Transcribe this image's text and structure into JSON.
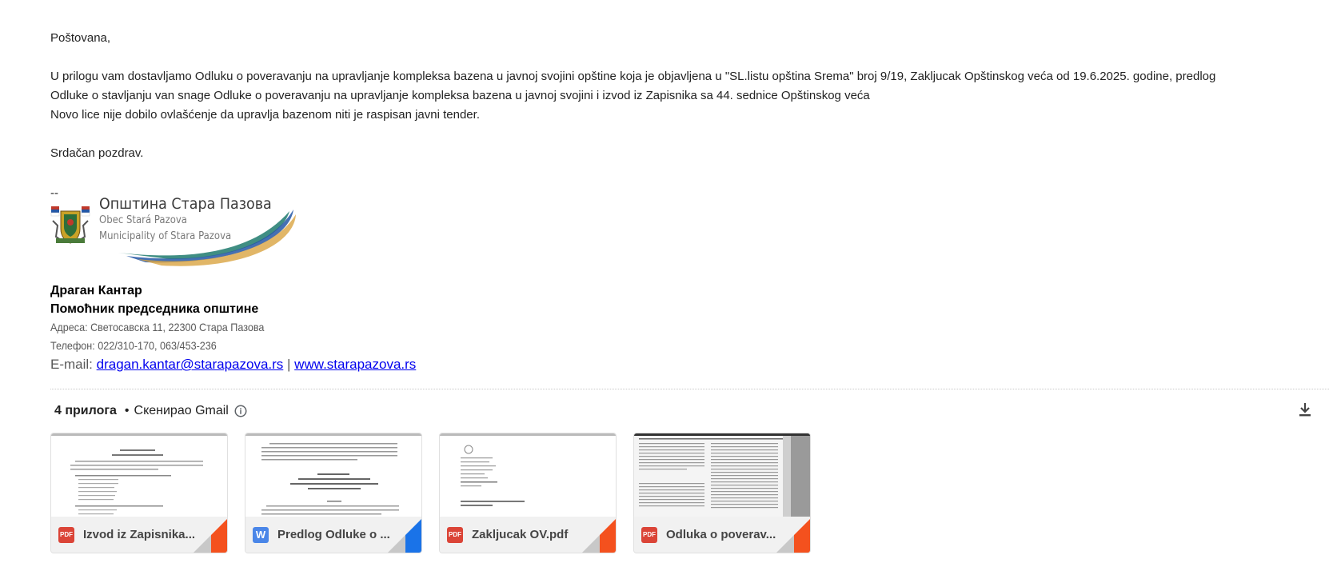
{
  "email": {
    "greeting": "Poštovana,",
    "body_line1": "U prilogu vam dostavljamo Odluku o poveravanju  na upravljanje kompleksa bazena u javnoj svojini opštine koja je objavljena u \"SL.listu opština Srema\" broj 9/19, Zakljucak Opštinskog veća od 19.6.2025. godine, predlog",
    "body_line2": "Odluke o stavljanju van snage Odluke o   poveravanju  na upravljanje kompleksa bazena u javnoj svojini  i izvod iz Zapisnika sa 44. sednice Opštinskog veća",
    "body_line3": "Novo lice nije dobilo ovlašćenje da upravlja bazenom niti je raspisan javni tender.",
    "closing": "Srdačan pozdrav.",
    "sig_dash": "--"
  },
  "logo": {
    "line1": "Општина Стара Пазова",
    "line2": "Obec Stará Pazova",
    "line3": "Municipality of Stara Pazova"
  },
  "signature": {
    "name": "Драган Кантар",
    "role": "Помоћник председника општине",
    "address": "Адреса: Светосавска 11, 22300 Стара Пазова",
    "phone": "Телефон: 022/310-170, 063/453-236",
    "email_label": "E-mail: ",
    "email": "dragan.kantar@starapazova.rs",
    "separator": " | ",
    "website": "www.starapazova.rs"
  },
  "attachments": {
    "count_label": "4 прилога",
    "separator": "•",
    "scanned_label": "Скенирао Gmail",
    "info_icon": "info-icon",
    "download_icon": "download-icon",
    "items": [
      {
        "name": "Izvod iz Zapisnika...",
        "type": "PDF",
        "icon_color": "#db4437",
        "corner_color": "#f4511e"
      },
      {
        "name": "Predlog Odluke o ...",
        "type": "W",
        "icon_color": "#4a86e8",
        "corner_color": "#1a73e8"
      },
      {
        "name": "Zakljucak OV.pdf",
        "type": "PDF",
        "icon_color": "#db4437",
        "corner_color": "#f4511e"
      },
      {
        "name": "Odluka o poverav...",
        "type": "PDF",
        "icon_color": "#db4437",
        "corner_color": "#f4511e"
      }
    ]
  }
}
